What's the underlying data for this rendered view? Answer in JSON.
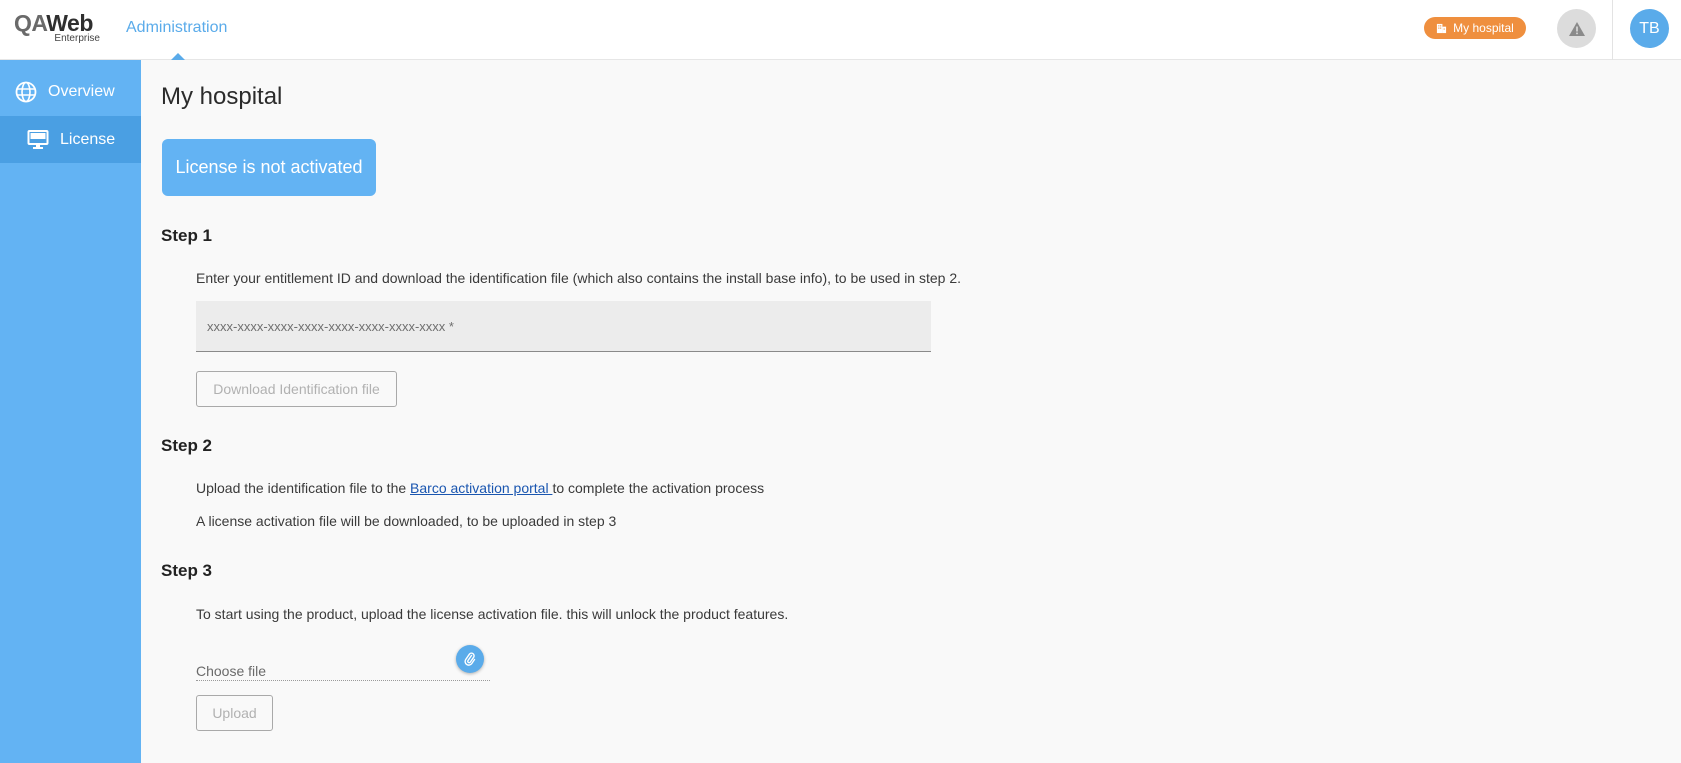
{
  "header": {
    "logo_qa": "QA",
    "logo_web": "Web",
    "logo_sub": "Enterprise",
    "nav_label": "Administration",
    "hospital_badge": "My hospital",
    "avatar_initials": "TB"
  },
  "sidebar": {
    "items": [
      {
        "label": "Overview",
        "icon": "globe-icon",
        "active": false
      },
      {
        "label": "License",
        "icon": "monitor-icon",
        "active": true
      }
    ]
  },
  "main": {
    "title": "My hospital",
    "status": "License is not activated",
    "step1": {
      "title": "Step 1",
      "description": "Enter your entitlement ID and download the identification file (which also contains the install base info), to be used in step 2.",
      "input_placeholder": "xxxx-xxxx-xxxx-xxxx-xxxx-xxxx-xxxx-xxxx *",
      "input_value": "",
      "download_button": "Download Identification file"
    },
    "step2": {
      "title": "Step 2",
      "line1_prefix": "Upload the identification file to the ",
      "line1_link": "Barco activation portal ",
      "line1_suffix": "to complete the activation process",
      "line2": "A license activation file will be downloaded, to be uploaded in step 3"
    },
    "step3": {
      "title": "Step 3",
      "description": "To start using the product, upload the license activation file. this will unlock the product features.",
      "file_label": "Choose file",
      "upload_button": "Upload"
    }
  },
  "colors": {
    "accent": "#5aabea",
    "sidebar": "#63b3f3",
    "sidebar_active": "#4a9fe3",
    "badge": "#ef8f3e",
    "link": "#1a56b0"
  }
}
